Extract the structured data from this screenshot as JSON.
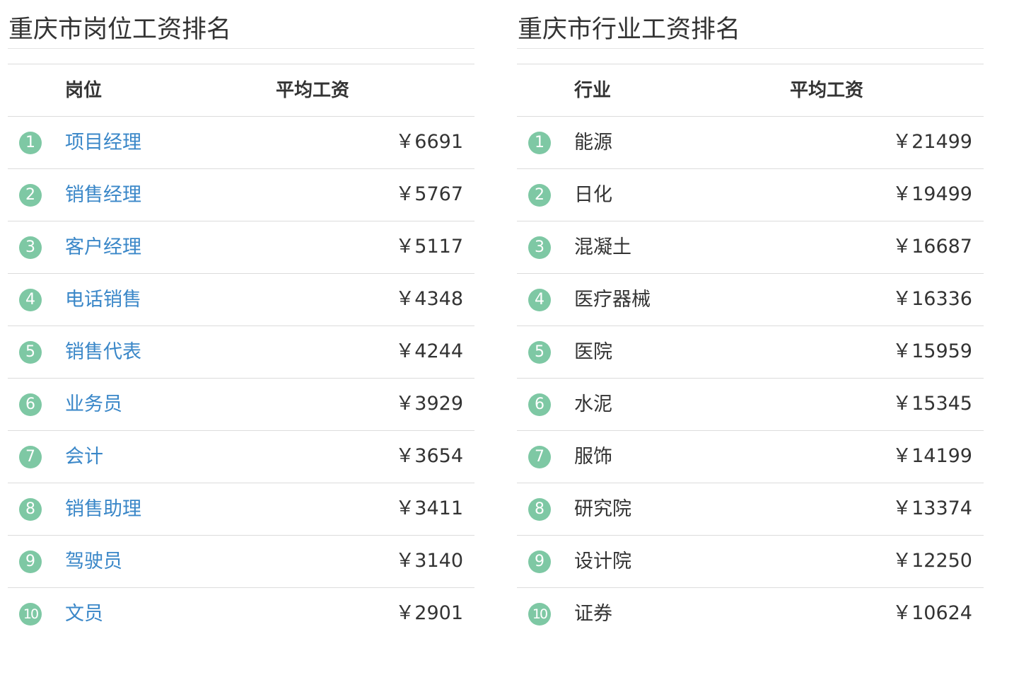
{
  "positions": {
    "title": "重庆市岗位工资排名",
    "col_name": "岗位",
    "col_salary": "平均工资",
    "rows": [
      {
        "rank": "1",
        "name": "项目经理",
        "salary": "￥6691"
      },
      {
        "rank": "2",
        "name": "销售经理",
        "salary": "￥5767"
      },
      {
        "rank": "3",
        "name": "客户经理",
        "salary": "￥5117"
      },
      {
        "rank": "4",
        "name": "电话销售",
        "salary": "￥4348"
      },
      {
        "rank": "5",
        "name": "销售代表",
        "salary": "￥4244"
      },
      {
        "rank": "6",
        "name": "业务员",
        "salary": "￥3929"
      },
      {
        "rank": "7",
        "name": "会计",
        "salary": "￥3654"
      },
      {
        "rank": "8",
        "name": "销售助理",
        "salary": "￥3411"
      },
      {
        "rank": "9",
        "name": "驾驶员",
        "salary": "￥3140"
      },
      {
        "rank": "10",
        "name": "文员",
        "salary": "￥2901"
      }
    ]
  },
  "industries": {
    "title": "重庆市行业工资排名",
    "col_name": "行业",
    "col_salary": "平均工资",
    "rows": [
      {
        "rank": "1",
        "name": "能源",
        "salary": "￥21499"
      },
      {
        "rank": "2",
        "name": "日化",
        "salary": "￥19499"
      },
      {
        "rank": "3",
        "name": "混凝土",
        "salary": "￥16687"
      },
      {
        "rank": "4",
        "name": "医疗器械",
        "salary": "￥16336"
      },
      {
        "rank": "5",
        "name": "医院",
        "salary": "￥15959"
      },
      {
        "rank": "6",
        "name": "水泥",
        "salary": "￥15345"
      },
      {
        "rank": "7",
        "name": "服饰",
        "salary": "￥14199"
      },
      {
        "rank": "8",
        "name": "研究院",
        "salary": "￥13374"
      },
      {
        "rank": "9",
        "name": "设计院",
        "salary": "￥12250"
      },
      {
        "rank": "10",
        "name": "证券",
        "salary": "￥10624"
      }
    ]
  },
  "colors": {
    "rank_badge": "#7ec8a4",
    "link": "#3a87c8",
    "text": "#333333",
    "divider": "#dcdcdc"
  }
}
